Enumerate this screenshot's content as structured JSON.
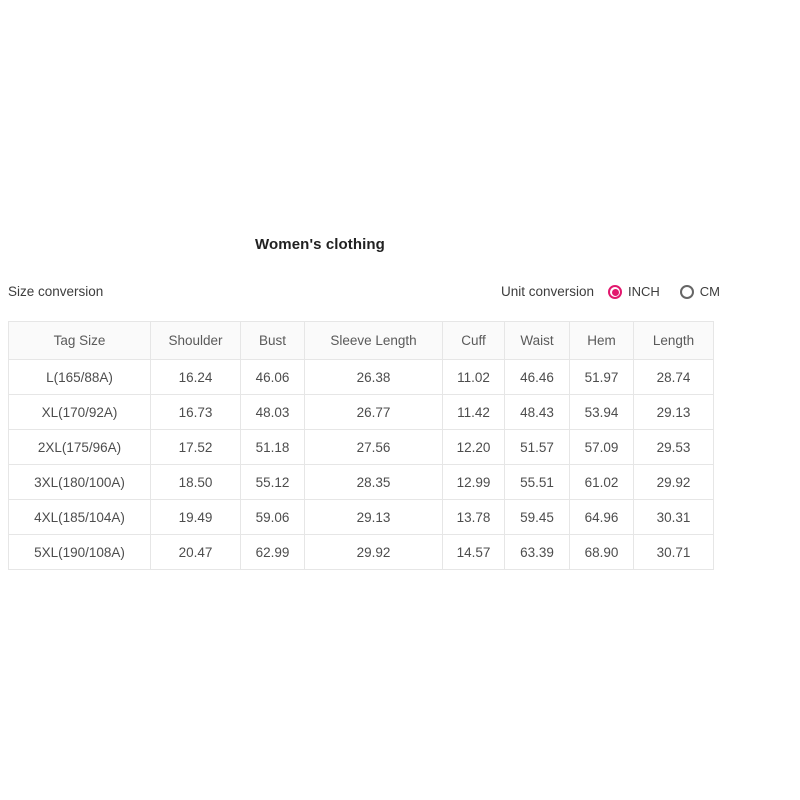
{
  "title": "Women's clothing",
  "size_conversion_label": "Size conversion",
  "unit_conversion": {
    "label": "Unit conversion",
    "selected": "INCH",
    "options": [
      {
        "value": "INCH",
        "label": "INCH",
        "checked": true
      },
      {
        "value": "CM",
        "label": "CM",
        "checked": false
      }
    ],
    "accent_color": "#e2186e"
  },
  "table": {
    "columns": [
      "Tag Size",
      "Shoulder",
      "Bust",
      "Sleeve Length",
      "Cuff",
      "Waist",
      "Hem",
      "Length"
    ],
    "rows": [
      [
        "L(165/88A)",
        "16.24",
        "46.06",
        "26.38",
        "11.02",
        "46.46",
        "51.97",
        "28.74"
      ],
      [
        "XL(170/92A)",
        "16.73",
        "48.03",
        "26.77",
        "11.42",
        "48.43",
        "53.94",
        "29.13"
      ],
      [
        "2XL(175/96A)",
        "17.52",
        "51.18",
        "27.56",
        "12.20",
        "51.57",
        "57.09",
        "29.53"
      ],
      [
        "3XL(180/100A)",
        "18.50",
        "55.12",
        "28.35",
        "12.99",
        "55.51",
        "61.02",
        "29.92"
      ],
      [
        "4XL(185/104A)",
        "19.49",
        "59.06",
        "29.13",
        "13.78",
        "59.45",
        "64.96",
        "30.31"
      ],
      [
        "5XL(190/108A)",
        "20.47",
        "62.99",
        "29.92",
        "14.57",
        "63.39",
        "68.90",
        "30.71"
      ]
    ]
  }
}
